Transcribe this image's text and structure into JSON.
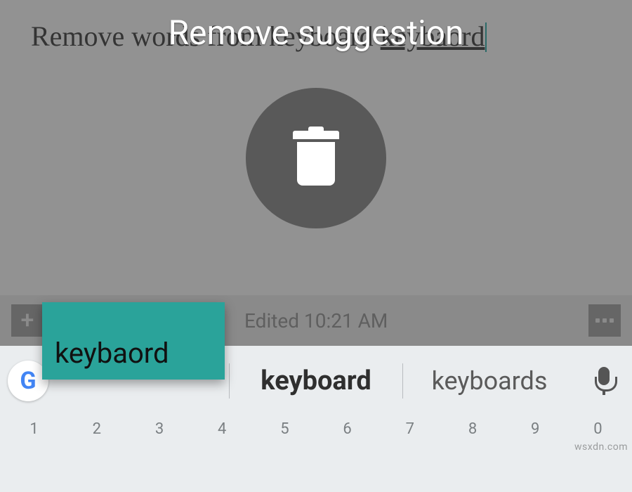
{
  "note": {
    "text_plain_part": "Remove words from keyboard ",
    "text_underlined_part": "keybaord"
  },
  "overlay": {
    "title": "Remove suggestion",
    "trash_icon_name": "trash-icon"
  },
  "drag_chip": {
    "label": "keybaord"
  },
  "toolbar": {
    "add_label": "+",
    "edited_label": "Edited 10:21 AM"
  },
  "suggestion_bar": {
    "google_icon_name": "google-g-icon",
    "slot_left": "",
    "slot_center": "keyboard",
    "slot_right": "keyboards",
    "mic_icon_name": "mic-icon"
  },
  "number_row": {
    "keys": [
      "1",
      "2",
      "3",
      "4",
      "5",
      "6",
      "7",
      "8",
      "9",
      "0"
    ]
  },
  "watermark": "wsxdn.com"
}
